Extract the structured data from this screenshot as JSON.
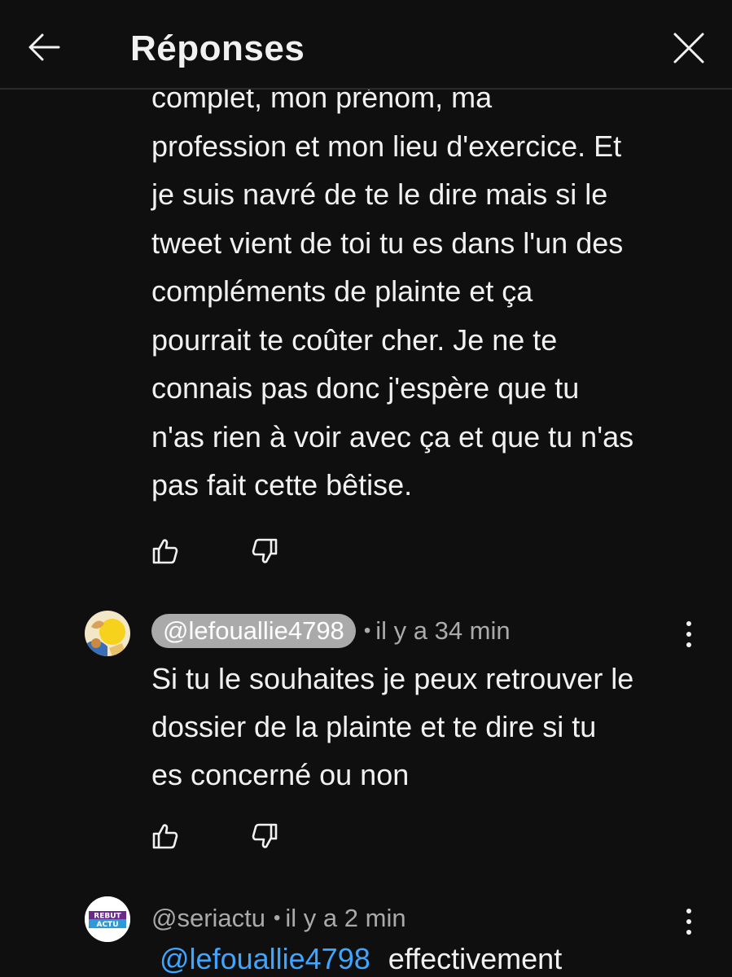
{
  "header": {
    "title": "Réponses",
    "back_icon": "arrow-left-icon",
    "close_icon": "close-icon"
  },
  "previous_comment": {
    "lines": [
      "complet, mon prénom, ma",
      "profession et mon lieu d'exercice. Et",
      "je suis navré de te le dire mais si le",
      "tweet vient de toi tu es dans l'un des",
      "compléments de plainte et ça",
      "pourrait te coûter cher. Je ne te",
      "connais pas donc j'espère que tu",
      "n'as rien à voir avec ça et que tu n'as",
      "pas fait cette bêtise."
    ]
  },
  "comments": [
    {
      "handle": "@lefouallie4798",
      "separator": "•",
      "time": "il y a 34 min",
      "lines": [
        "Si tu le souhaites je peux retrouver le",
        "dossier de la plainte et te dire si tu",
        "es concerné ou non"
      ]
    },
    {
      "handle": "@seriactu",
      "separator": "•",
      "time": "il y a 2 min",
      "avatar_text_top": "REBUT",
      "avatar_text_bottom": "ACTU",
      "mention": "@lefouallie4798",
      "text_after_mention": "effectivement"
    }
  ],
  "colors": {
    "background": "#0f0f0f",
    "text": "#f1f1f1",
    "secondary": "#aaaaaa",
    "link": "#3ea6ff"
  }
}
